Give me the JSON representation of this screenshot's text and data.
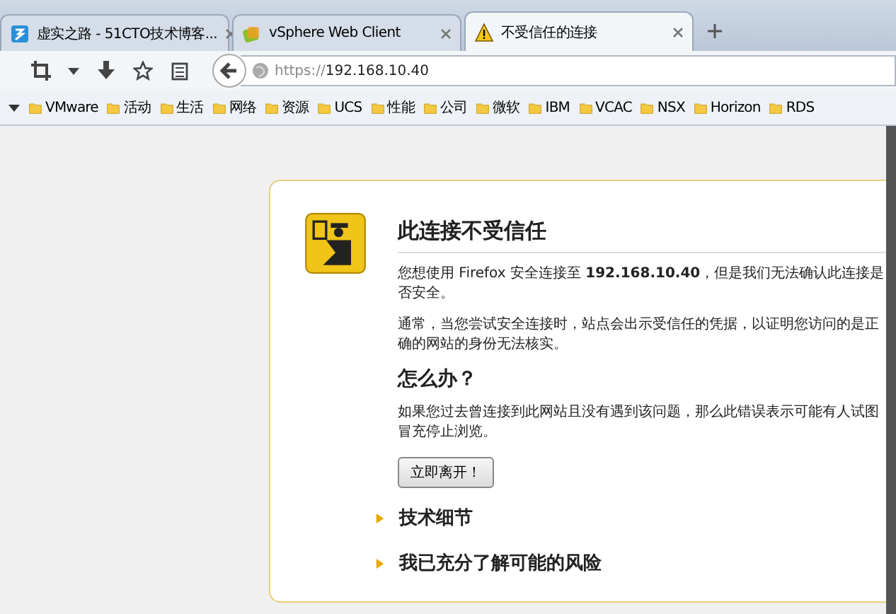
{
  "tabs": [
    {
      "title": "虚实之路 - 51CTO技术博客...",
      "selected": false
    },
    {
      "title": "vSphere Web Client",
      "selected": false
    },
    {
      "title": "不受信任的连接",
      "selected": true
    }
  ],
  "address": {
    "scheme": "https://",
    "host": "192.168.10.40"
  },
  "bookmarks": [
    "VMware",
    "活动",
    "生活",
    "网络",
    "资源",
    "UCS",
    "性能",
    "公司",
    "微软",
    "IBM",
    "VCAC",
    "NSX",
    "Horizon",
    "RDS"
  ],
  "error": {
    "title": "此连接不受信任",
    "intro": "您想使用 Firefox 安全连接至 **192.168.10.40**，但是我们无法确认此连接是否安全。",
    "detail": "通常，当您尝试安全连接时，站点会出示受信任的凭据，以证明您访问的是正确的网站的身份无法核实。",
    "what_title": "怎么办？",
    "what_text": "如果您过去曾连接到此网站且没有遇到该问题，那么此错误表示可能有人试图冒充停止浏览。",
    "button": "立即离开！",
    "sections": [
      {
        "title": "技术细节",
        "expanded": false
      },
      {
        "title": "我已充分了解可能的风险",
        "expanded": false
      }
    ]
  }
}
